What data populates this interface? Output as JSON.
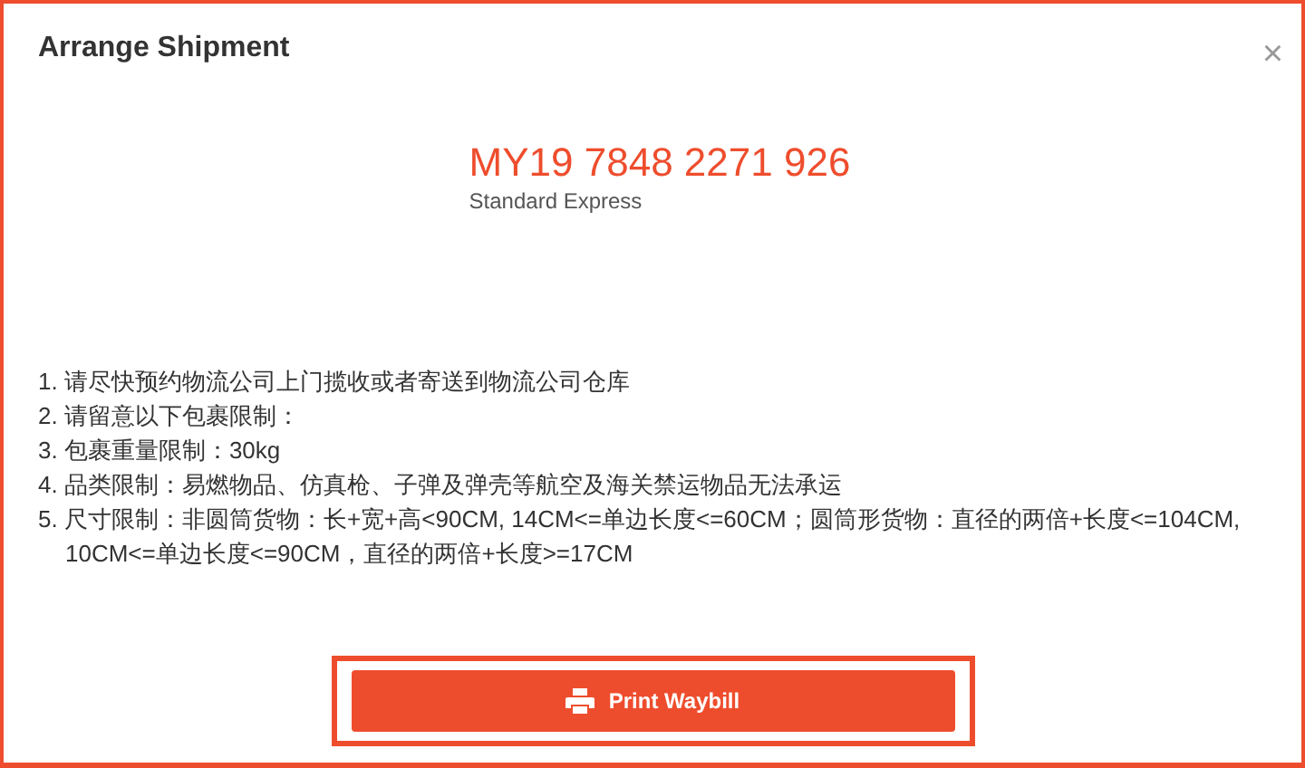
{
  "dialog": {
    "title": "Arrange Shipment",
    "close": "×"
  },
  "tracking": {
    "number": "MY19 7848 2271 926",
    "service": "Standard Express"
  },
  "notes": [
    "1. 请尽快预约物流公司上门揽收或者寄送到物流公司仓库",
    "2. 请留意以下包裹限制：",
    "3. 包裹重量限制：30kg",
    "4. 品类限制：易燃物品、仿真枪、子弹及弹壳等航空及海关禁运物品无法承运",
    "5. 尺寸限制：非圆筒货物：长+宽+高<90CM, 14CM<=单边长度<=60CM；圆筒形货物：直径的两倍+长度<=104CM, 10CM<=单边长度<=90CM，直径的两倍+长度>=17CM"
  ],
  "button": {
    "label": "Print Waybill"
  }
}
